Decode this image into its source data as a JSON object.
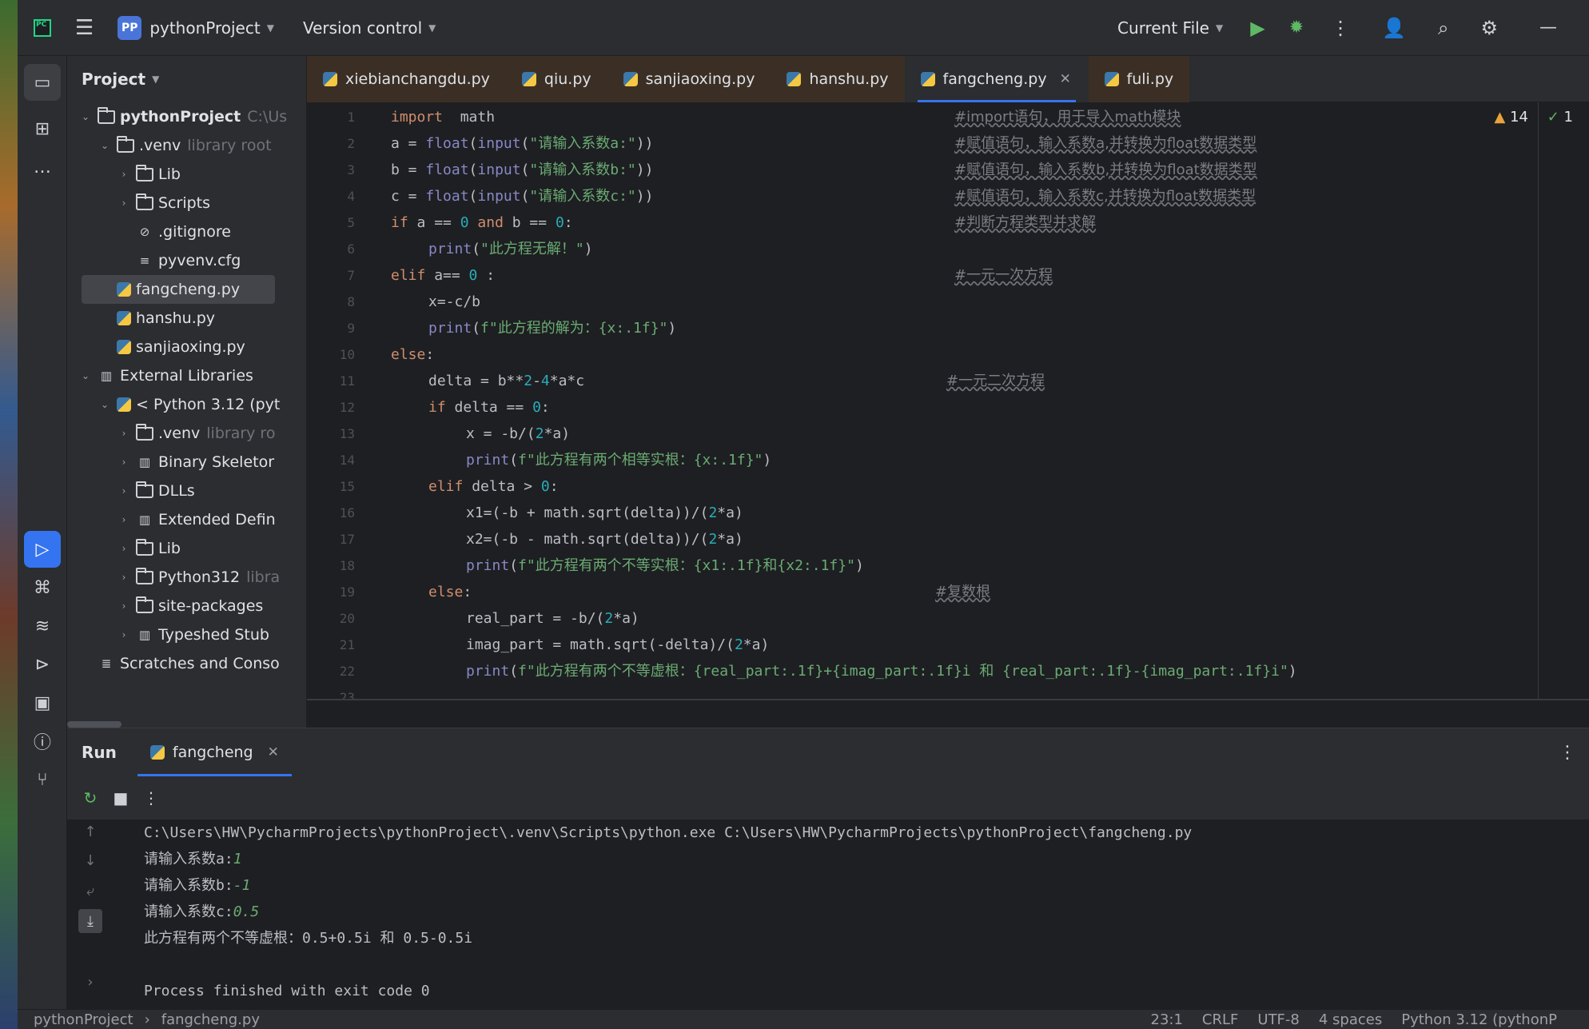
{
  "topbar": {
    "project_badge": "PP",
    "project_name": "pythonProject",
    "version_control": "Version control",
    "run_config": "Current File"
  },
  "project_panel": {
    "title": "Project",
    "tree": [
      {
        "label": "pythonProject",
        "suffix": "C:\\Us",
        "type": "folder",
        "level": 0,
        "expanded": true,
        "bold": true
      },
      {
        "label": ".venv",
        "suffix": "library root",
        "type": "folder",
        "level": 1,
        "expanded": true
      },
      {
        "label": "Lib",
        "suffix": "",
        "type": "folder",
        "level": 2,
        "expanded": false
      },
      {
        "label": "Scripts",
        "suffix": "",
        "type": "folder",
        "level": 2,
        "expanded": false
      },
      {
        "label": ".gitignore",
        "suffix": "",
        "type": "ignore",
        "level": 2
      },
      {
        "label": "pyvenv.cfg",
        "suffix": "",
        "type": "cfg",
        "level": 2
      },
      {
        "label": "fangcheng.py",
        "suffix": "",
        "type": "py",
        "level": 1,
        "selected": true
      },
      {
        "label": "hanshu.py",
        "suffix": "",
        "type": "py",
        "level": 1
      },
      {
        "label": "sanjiaoxing.py",
        "suffix": "",
        "type": "py",
        "level": 1
      },
      {
        "label": "External Libraries",
        "suffix": "",
        "type": "lib",
        "level": 0,
        "expanded": true
      },
      {
        "label": "< Python 3.12 (pyt",
        "suffix": "",
        "type": "py",
        "level": 1,
        "expanded": true
      },
      {
        "label": ".venv",
        "suffix": "library ro",
        "type": "folder",
        "level": 2,
        "expanded": false
      },
      {
        "label": "Binary Skeletor",
        "suffix": "",
        "type": "lib",
        "level": 2,
        "expanded": false
      },
      {
        "label": "DLLs",
        "suffix": "",
        "type": "folder",
        "level": 2,
        "expanded": false
      },
      {
        "label": "Extended Defin",
        "suffix": "",
        "type": "lib",
        "level": 2,
        "expanded": false
      },
      {
        "label": "Lib",
        "suffix": "",
        "type": "folder",
        "level": 2,
        "expanded": false
      },
      {
        "label": "Python312",
        "suffix": "libra",
        "type": "folder",
        "level": 2,
        "expanded": false
      },
      {
        "label": "site-packages",
        "suffix": "",
        "type": "folder",
        "level": 2,
        "expanded": false
      },
      {
        "label": "Typeshed Stub",
        "suffix": "",
        "type": "lib",
        "level": 2,
        "expanded": false
      },
      {
        "label": "Scratches and Conso",
        "suffix": "",
        "type": "scratch",
        "level": 0
      }
    ]
  },
  "tabs": [
    {
      "label": "xiebianchangdu.py",
      "active": false
    },
    {
      "label": "qiu.py",
      "active": false
    },
    {
      "label": "sanjiaoxing.py",
      "active": false
    },
    {
      "label": "hanshu.py",
      "active": false
    },
    {
      "label": "fangcheng.py",
      "active": true
    },
    {
      "label": "fuli.py",
      "active": false
    }
  ],
  "editor": {
    "warnings": "14",
    "ok_count": "1",
    "lines": [
      {
        "n": "1",
        "indent": 0,
        "code": [
          [
            "kw",
            "import"
          ],
          [
            "",
            "  math"
          ]
        ],
        "comment": "#import语句，用于导入math模块",
        "cpos": 0
      },
      {
        "n": "2",
        "indent": 0,
        "code": [
          [
            "",
            "a = "
          ],
          [
            "bi",
            "float"
          ],
          [
            "",
            "("
          ],
          [
            "bi",
            "input"
          ],
          [
            "",
            "("
          ],
          [
            "st",
            "\"请输入系数a:\""
          ],
          [
            "",
            "))"
          ]
        ],
        "comment": "#赋值语句，输入系数a,并转换为float数据类型",
        "cpos": 0
      },
      {
        "n": "3",
        "indent": 0,
        "code": [
          [
            "",
            "b = "
          ],
          [
            "bi",
            "float"
          ],
          [
            "",
            "("
          ],
          [
            "bi",
            "input"
          ],
          [
            "",
            "("
          ],
          [
            "st",
            "\"请输入系数b:\""
          ],
          [
            "",
            "))"
          ]
        ],
        "comment": "#赋值语句，输入系数b,并转换为float数据类型",
        "cpos": 0
      },
      {
        "n": "4",
        "indent": 0,
        "code": [
          [
            "",
            "c = "
          ],
          [
            "bi",
            "float"
          ],
          [
            "",
            "("
          ],
          [
            "bi",
            "input"
          ],
          [
            "",
            "("
          ],
          [
            "st",
            "\"请输入系数c:\""
          ],
          [
            "",
            "))"
          ]
        ],
        "comment": "#赋值语句，输入系数c,并转换为float数据类型",
        "cpos": 0
      },
      {
        "n": "5",
        "indent": 0,
        "code": [
          [
            "kw",
            "if"
          ],
          [
            "",
            " a == "
          ],
          [
            "nm",
            "0"
          ],
          [
            "",
            " "
          ],
          [
            "kw",
            "and"
          ],
          [
            "",
            " b == "
          ],
          [
            "nm",
            "0"
          ],
          [
            "",
            ":"
          ]
        ],
        "comment": "#判断方程类型并求解",
        "cpos": 0
      },
      {
        "n": "6",
        "indent": 1,
        "code": [
          [
            "bi",
            "print"
          ],
          [
            "",
            "("
          ],
          [
            "st",
            "\"此方程无解！\""
          ],
          [
            "",
            ")"
          ]
        ],
        "comment": "",
        "cpos": 0
      },
      {
        "n": "7",
        "indent": 0,
        "code": [
          [
            "kw",
            "elif"
          ],
          [
            "",
            " a== "
          ],
          [
            "nm",
            "0"
          ],
          [
            "",
            " :"
          ]
        ],
        "comment": "#一元一次方程",
        "cpos": 0
      },
      {
        "n": "8",
        "indent": 1,
        "code": [
          [
            "",
            "x=-c/b"
          ]
        ],
        "comment": "",
        "cpos": 0
      },
      {
        "n": "9",
        "indent": 1,
        "code": [
          [
            "bi",
            "print"
          ],
          [
            "",
            "("
          ],
          [
            "st",
            "f\"此方程的解为：{x:.1f}\""
          ],
          [
            "",
            ")"
          ]
        ],
        "comment": "",
        "cpos": 0
      },
      {
        "n": "10",
        "indent": 0,
        "code": [
          [
            "kw",
            "else"
          ],
          [
            "",
            ":"
          ]
        ],
        "comment": "",
        "cpos": 0
      },
      {
        "n": "11",
        "indent": 1,
        "code": [
          [
            "",
            "delta = b**"
          ],
          [
            "nm",
            "2"
          ],
          [
            "",
            "-"
          ],
          [
            "nm",
            "4"
          ],
          [
            "",
            "*a*c"
          ]
        ],
        "comment": "#一元二次方程",
        "cpos": 1
      },
      {
        "n": "12",
        "indent": 1,
        "code": [
          [
            "kw",
            "if"
          ],
          [
            "",
            " delta == "
          ],
          [
            "nm",
            "0"
          ],
          [
            "",
            ":"
          ]
        ],
        "comment": "",
        "cpos": 0
      },
      {
        "n": "13",
        "indent": 2,
        "code": [
          [
            "",
            "x = -b/("
          ],
          [
            "nm",
            "2"
          ],
          [
            "",
            "*a)"
          ]
        ],
        "comment": "",
        "cpos": 0
      },
      {
        "n": "14",
        "indent": 2,
        "code": [
          [
            "bi",
            "print"
          ],
          [
            "",
            "("
          ],
          [
            "st",
            "f\"此方程有两个相等实根：{x:.1f}\""
          ],
          [
            "",
            ")"
          ]
        ],
        "comment": "",
        "cpos": 0
      },
      {
        "n": "15",
        "indent": 1,
        "code": [
          [
            "kw",
            "elif"
          ],
          [
            "",
            " delta > "
          ],
          [
            "nm",
            "0"
          ],
          [
            "",
            ":"
          ]
        ],
        "comment": "",
        "cpos": 0
      },
      {
        "n": "16",
        "indent": 2,
        "code": [
          [
            "",
            "x1=(-b + math.sqrt(delta))/("
          ],
          [
            "nm",
            "2"
          ],
          [
            "",
            "*a)"
          ]
        ],
        "comment": "",
        "cpos": 0
      },
      {
        "n": "17",
        "indent": 2,
        "code": [
          [
            "",
            "x2=(-b - math.sqrt(delta))/("
          ],
          [
            "nm",
            "2"
          ],
          [
            "",
            "*a)"
          ]
        ],
        "comment": "",
        "cpos": 0
      },
      {
        "n": "18",
        "indent": 2,
        "code": [
          [
            "bi",
            "print"
          ],
          [
            "",
            "("
          ],
          [
            "st",
            "f\"此方程有两个不等实根：{x1:.1f}和{x2:.1f}\""
          ],
          [
            "",
            ")"
          ]
        ],
        "comment": "",
        "cpos": 0
      },
      {
        "n": "19",
        "indent": 1,
        "code": [
          [
            "kw",
            "else"
          ],
          [
            "",
            ":"
          ]
        ],
        "comment": "#复数根",
        "cpos": 2
      },
      {
        "n": "20",
        "indent": 2,
        "code": [
          [
            "",
            "real_part = -b/("
          ],
          [
            "nm",
            "2"
          ],
          [
            "",
            "*a)"
          ]
        ],
        "comment": "",
        "cpos": 0
      },
      {
        "n": "21",
        "indent": 2,
        "code": [
          [
            "",
            "imag_part = math.sqrt(-delta)/("
          ],
          [
            "nm",
            "2"
          ],
          [
            "",
            "*a)"
          ]
        ],
        "comment": "",
        "cpos": 0
      },
      {
        "n": "22",
        "indent": 2,
        "code": [
          [
            "bi",
            "print"
          ],
          [
            "",
            "("
          ],
          [
            "st",
            "f\"此方程有两个不等虚根：{real_part:.1f}+{imag_part:.1f}i 和 {real_part:.1f}-{imag_part:.1f}i\""
          ],
          [
            "",
            ")"
          ]
        ],
        "comment": "",
        "cpos": 0
      },
      {
        "n": "23",
        "indent": 0,
        "code": [],
        "comment": "",
        "cpos": 0
      }
    ]
  },
  "run_panel": {
    "title": "Run",
    "tab_label": "fangcheng",
    "console": [
      {
        "text": "C:\\Users\\HW\\PycharmProjects\\pythonProject\\.venv\\Scripts\\python.exe C:\\Users\\HW\\PycharmProjects\\pythonProject\\fangcheng.py",
        "input": ""
      },
      {
        "text": "请输入系数a:",
        "input": "1"
      },
      {
        "text": "请输入系数b:",
        "input": "-1"
      },
      {
        "text": "请输入系数c:",
        "input": "0.5"
      },
      {
        "text": "此方程有两个不等虚根：0.5+0.5i 和 0.5-0.5i",
        "input": ""
      },
      {
        "text": "",
        "input": ""
      },
      {
        "text": "Process finished with exit code 0",
        "input": ""
      }
    ]
  },
  "statusbar": {
    "project": "pythonProject",
    "file": "fangcheng.py",
    "position": "23:1",
    "line_sep": "CRLF",
    "encoding": "UTF-8",
    "indent": "4 spaces",
    "interpreter": "Python 3.12 (pythonP"
  },
  "colors": {
    "accent": "#3574f0",
    "keyword": "#cf8e6d",
    "builtin": "#8888c6",
    "string": "#6aab73",
    "number": "#2aacb8",
    "comment": "#7a7e85",
    "run_green": "#5fb865",
    "warning": "#e8a33d"
  }
}
